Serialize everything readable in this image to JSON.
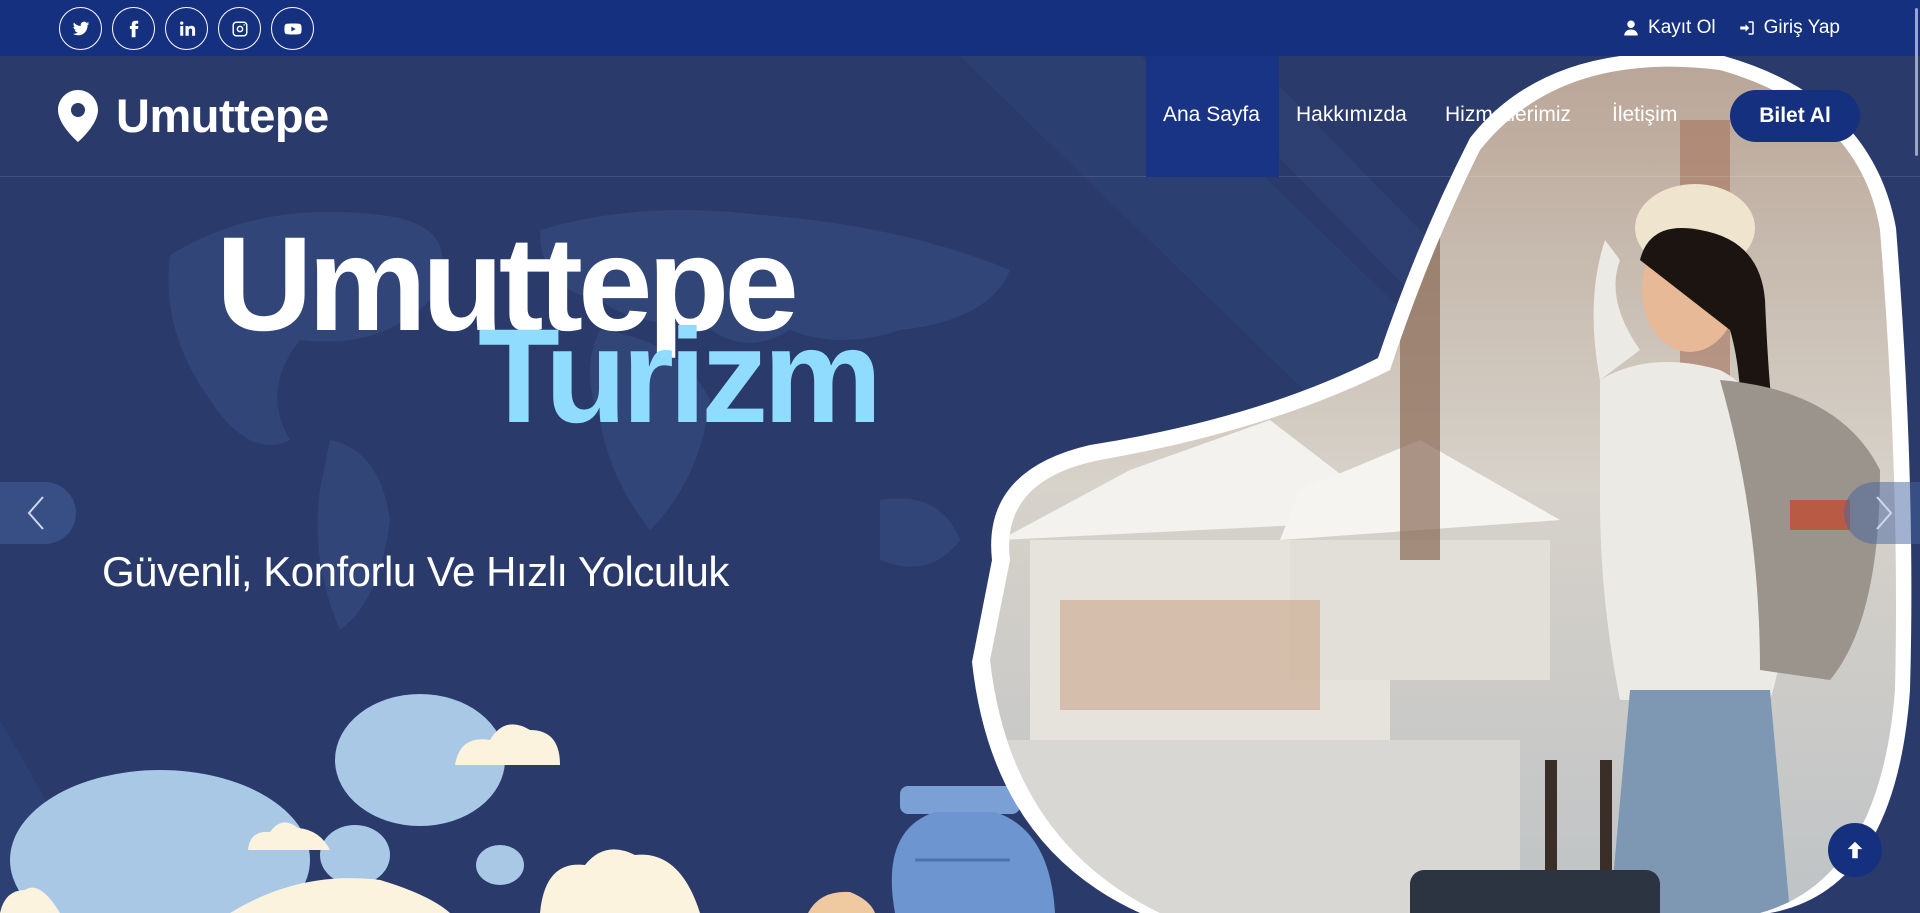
{
  "topbar": {
    "socials": [
      {
        "icon": "twitter-icon"
      },
      {
        "icon": "facebook-icon"
      },
      {
        "icon": "linkedin-icon"
      },
      {
        "icon": "instagram-icon"
      },
      {
        "icon": "youtube-icon"
      }
    ],
    "register_label": "Kayıt Ol",
    "login_label": "Giriş Yap"
  },
  "nav": {
    "brand": "Umuttepe",
    "items": [
      {
        "label": "Ana Sayfa",
        "active": true
      },
      {
        "label": "Hakkımızda"
      },
      {
        "label": "Hizmetlerimiz"
      },
      {
        "label": "İletişim"
      }
    ],
    "cta_label": "Bilet Al"
  },
  "hero": {
    "title_line1": "Umuttepe",
    "title_line2": "Turizm",
    "subtitle": "Güvenli, Konforlu Ve Hızlı Yolculuk"
  },
  "colors": {
    "topbar": "#15307f",
    "hero_bg": "#2a3b6b",
    "accent_title": "#90dcff",
    "button": "#15307f"
  }
}
